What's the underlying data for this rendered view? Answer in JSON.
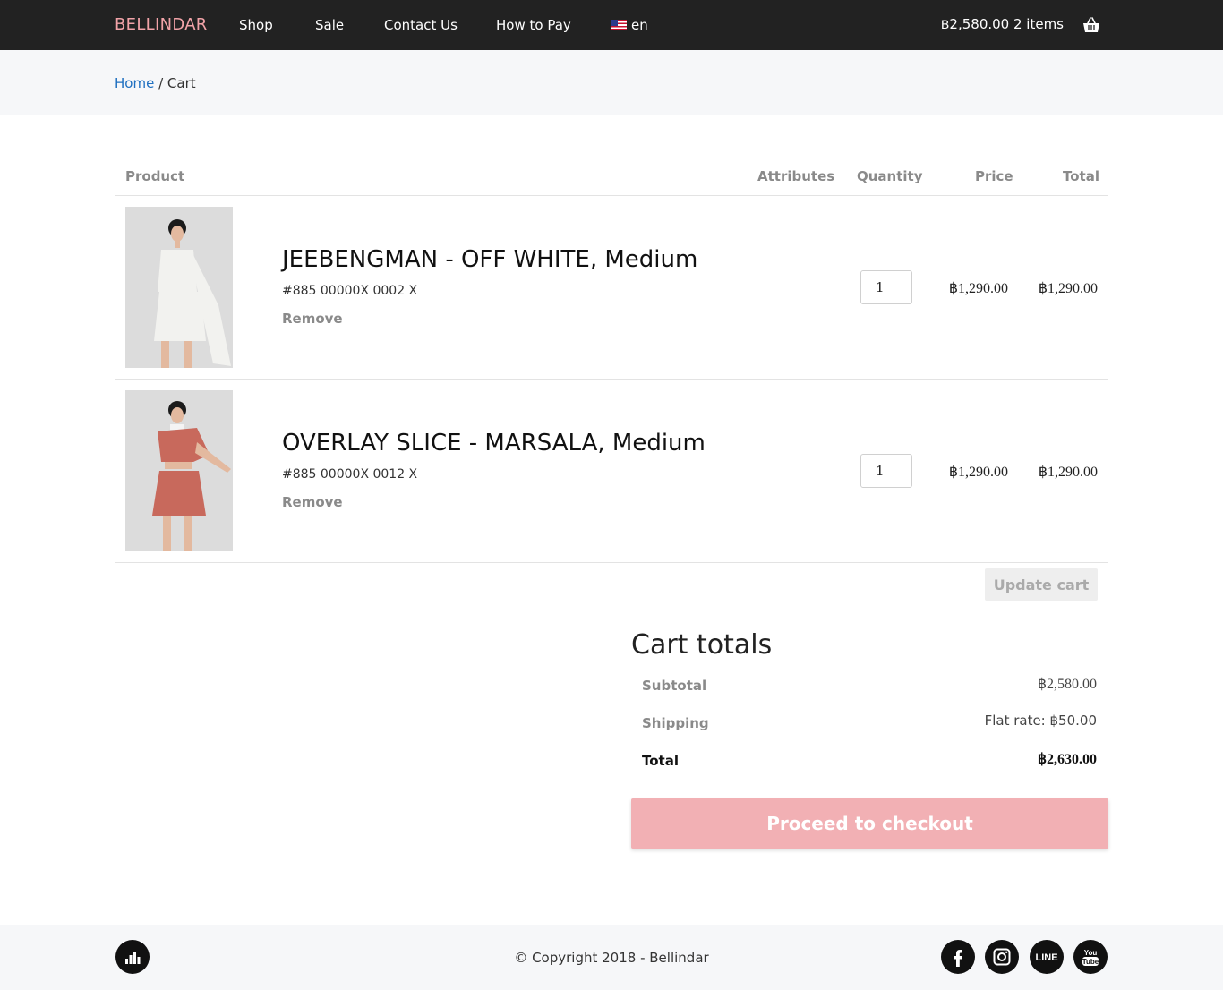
{
  "brand": "BELLINDAR",
  "nav": {
    "items": [
      "Shop",
      "Sale",
      "Contact Us",
      "How to Pay"
    ],
    "language": "en",
    "cart_summary": "฿2,580.00 2 items"
  },
  "breadcrumb": {
    "home": "Home",
    "separator": "/",
    "current": "Cart"
  },
  "table": {
    "headers": {
      "product": "Product",
      "attributes": "Attributes",
      "quantity": "Quantity",
      "price": "Price",
      "total": "Total"
    },
    "rows": [
      {
        "name": "JEEBENGMAN - OFF WHITE, Medium",
        "sku": "#885 00000X 0002 X",
        "remove": "Remove",
        "quantity": "1",
        "price": "฿1,290.00",
        "total": "฿1,290.00",
        "garment_color": "#f2f2ef"
      },
      {
        "name": "OVERLAY SLICE - MARSALA, Medium",
        "sku": "#885 00000X 0012 X",
        "remove": "Remove",
        "quantity": "1",
        "price": "฿1,290.00",
        "total": "฿1,290.00",
        "garment_color": "#c8695c"
      }
    ],
    "update_label": "Update cart"
  },
  "totals": {
    "title": "Cart totals",
    "subtotal_label": "Subtotal",
    "subtotal_value": "฿2,580.00",
    "shipping_label": "Shipping",
    "shipping_value": "Flat rate: ฿50.00",
    "total_label": "Total",
    "total_value": "฿2,630.00",
    "checkout_label": "Proceed to checkout"
  },
  "footer": {
    "copyright": "© Copyright 2018 - Bellindar",
    "social": [
      "facebook",
      "instagram",
      "line",
      "youtube"
    ],
    "line_text": "LINE",
    "youtube_text_1": "You",
    "youtube_text_2": "Tube"
  },
  "colors": {
    "navbar": "#222222",
    "brand": "#f2a3a8",
    "link": "#1e6fc0",
    "checkout": "#f2b0b4"
  }
}
